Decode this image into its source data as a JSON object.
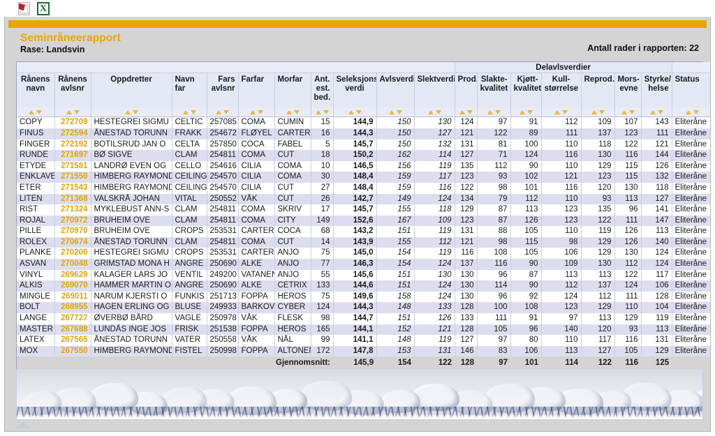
{
  "export_bar": {
    "pdf": {
      "icon": "pdf-export-icon",
      "title": "PDF"
    },
    "excel": {
      "icon": "excel-export-icon",
      "title": "Excel",
      "glyph": "X"
    }
  },
  "report": {
    "title": "Seminråneerapport",
    "title_text": "Seminråneerapport",
    "subtitle": "Rase: Landsvin",
    "row_count_label": "Antall rader i rapporten: 22",
    "accent_color": "#e8a607",
    "avlsnr_color": "#e0a30b"
  },
  "table": {
    "group_header": "Delavlsverdier",
    "columns": [
      "Rånens navn",
      "Rånens avlsnr",
      "Oppdretter",
      "Navn far",
      "Fars avlsnr",
      "Farfar",
      "Morfar",
      "Ant. est. bed.",
      "Seleksjons- verdi",
      "Avlsverdi",
      "Slektverdi",
      "Prod.",
      "Slakte- kvalitet",
      "Kjøtt- kvalitet",
      "Kull- størrelse",
      "Reprod.",
      "Mors- evne",
      "Styrke/ helse",
      "Status"
    ],
    "columns_split": [
      [
        "Rånens",
        "navn"
      ],
      [
        "Rånens",
        "avlsnr"
      ],
      [
        "Oppdretter",
        ""
      ],
      [
        "Navn far",
        ""
      ],
      [
        "Fars",
        "avlsnr"
      ],
      [
        "Farfar",
        ""
      ],
      [
        "Morfar",
        ""
      ],
      [
        "Ant.",
        "est.",
        "bed."
      ],
      [
        "Seleksjons-",
        "verdi"
      ],
      [
        "Avlsverdi",
        ""
      ],
      [
        "Slektverdi",
        ""
      ],
      [
        "Prod.",
        ""
      ],
      [
        "Slakte-",
        "kvalitet"
      ],
      [
        "Kjøtt-",
        "kvalitet"
      ],
      [
        "Kull-",
        "størrelse"
      ],
      [
        "Reprod.",
        ""
      ],
      [
        "Mors-",
        "evne"
      ],
      [
        "Styrke/",
        "helse"
      ],
      [
        "Status",
        ""
      ]
    ],
    "sort_icons": {
      "asc": "sort-ascending-icon",
      "desc": "sort-descending-icon"
    },
    "rows": [
      [
        "COPY",
        "272709",
        "HESTEGREI SIGMU",
        "CELTIC",
        "257085",
        "COMA",
        "CUMIN",
        "15",
        "144,9",
        "150",
        "130",
        "124",
        "97",
        "91",
        "112",
        "109",
        "107",
        "143",
        "Eliteråne"
      ],
      [
        "FINUS",
        "272594",
        "ÅNESTAD TORUNN",
        "FRAKK",
        "254672",
        "FLØYEL",
        "CARTER",
        "16",
        "144,3",
        "150",
        "127",
        "121",
        "122",
        "89",
        "111",
        "137",
        "123",
        "111",
        "Eliteråne"
      ],
      [
        "FINGER",
        "272192",
        "BOTILSRUD JAN O",
        "CELTA",
        "257850",
        "COCA",
        "FABEL",
        "5",
        "145,7",
        "150",
        "132",
        "131",
        "81",
        "100",
        "110",
        "118",
        "122",
        "121",
        "Eliteråne"
      ],
      [
        "RUNDE",
        "271697",
        "BØ SIGVE",
        "CLAM",
        "254811",
        "COMA",
        "CUT",
        "18",
        "150,2",
        "162",
        "114",
        "127",
        "71",
        "124",
        "116",
        "130",
        "116",
        "144",
        "Eliteråne"
      ],
      [
        "ETYDE",
        "271581",
        "LANDRØ EVEN OG",
        "CELLO",
        "254616",
        "CILIA",
        "COMA",
        "10",
        "146,5",
        "156",
        "119",
        "135",
        "112",
        "90",
        "110",
        "129",
        "115",
        "126",
        "Eliteråne"
      ],
      [
        "ENKLAVE",
        "271550",
        "HIMBERG RAYMOND",
        "CEILING",
        "254570",
        "CILIA",
        "COMA",
        "30",
        "148,4",
        "159",
        "117",
        "123",
        "93",
        "102",
        "121",
        "123",
        "115",
        "132",
        "Eliteråne"
      ],
      [
        "ETER",
        "271543",
        "HIMBERG RAYMOND",
        "CEILING",
        "254570",
        "CILIA",
        "CUT",
        "27",
        "148,4",
        "159",
        "116",
        "122",
        "98",
        "101",
        "116",
        "120",
        "130",
        "118",
        "Eliteråne"
      ],
      [
        "LITEN",
        "271368",
        "VALSKRÅ JOHAN",
        "VITAL",
        "250552",
        "VÅK",
        "CUT",
        "26",
        "142,7",
        "149",
        "124",
        "134",
        "79",
        "112",
        "110",
        "93",
        "113",
        "127",
        "Eliteråne"
      ],
      [
        "RIST",
        "271324",
        "MYKLEBUST ANN-S",
        "CLAM",
        "254811",
        "COMA",
        "SKRIV",
        "17",
        "145,7",
        "155",
        "118",
        "129",
        "87",
        "113",
        "123",
        "135",
        "96",
        "141",
        "Eliteråne"
      ],
      [
        "ROJAL",
        "270972",
        "BRUHEIM OVE",
        "CLAM",
        "254811",
        "COMA",
        "CITY",
        "149",
        "152,6",
        "167",
        "109",
        "123",
        "87",
        "126",
        "123",
        "122",
        "111",
        "147",
        "Eliteråne"
      ],
      [
        "PILLE",
        "270970",
        "BRUHEIM OVE",
        "CROPS",
        "253531",
        "CARTER",
        "COCA",
        "68",
        "143,2",
        "151",
        "119",
        "131",
        "88",
        "105",
        "110",
        "119",
        "126",
        "113",
        "Eliteråne"
      ],
      [
        "ROLEX",
        "270674",
        "ÅNESTAD TORUNN",
        "CLAM",
        "254811",
        "COMA",
        "CUT",
        "14",
        "143,9",
        "155",
        "112",
        "121",
        "98",
        "115",
        "98",
        "129",
        "126",
        "140",
        "Eliteråne"
      ],
      [
        "PLANKE",
        "270200",
        "HESTEGREI SIGMU",
        "CROPS",
        "253531",
        "CARTER",
        "ANJO",
        "75",
        "145,0",
        "154",
        "119",
        "116",
        "108",
        "105",
        "106",
        "129",
        "130",
        "124",
        "Eliteråne"
      ],
      [
        "ASVAN",
        "270048",
        "GRIMSTAD MONA H",
        "ANGRE",
        "250690",
        "ALKE",
        "ANJO",
        "77",
        "146,3",
        "154",
        "124",
        "137",
        "116",
        "90",
        "109",
        "130",
        "112",
        "124",
        "Eliteråne"
      ],
      [
        "VINYL",
        "269629",
        "KALAGER LARS JO",
        "VENTIL",
        "249200",
        "VATANEN",
        "ANJO",
        "55",
        "145,6",
        "151",
        "130",
        "130",
        "96",
        "87",
        "113",
        "113",
        "122",
        "117",
        "Eliteråne"
      ],
      [
        "ALKIS",
        "269070",
        "HAMMER MARTIN O",
        "ANGRE",
        "250690",
        "ALKE",
        "CETRIX",
        "133",
        "144,6",
        "151",
        "124",
        "130",
        "114",
        "90",
        "112",
        "137",
        "124",
        "106",
        "Eliteråne"
      ],
      [
        "MINGLE",
        "269011",
        "NARUM KJERSTI O",
        "FUNKIS",
        "251713",
        "FOPPA",
        "HEROS",
        "75",
        "149,6",
        "158",
        "124",
        "130",
        "96",
        "92",
        "124",
        "112",
        "111",
        "128",
        "Eliteråne"
      ],
      [
        "BOLT",
        "268955",
        "HAGEN ERLING OG",
        "BLUSE",
        "249933",
        "BARKOV",
        "CYBER",
        "124",
        "144,3",
        "148",
        "133",
        "128",
        "100",
        "108",
        "123",
        "129",
        "110",
        "104",
        "Eliteråne"
      ],
      [
        "LANGE",
        "267727",
        "ØVERBØ BÅRD",
        "VAGLE",
        "250978",
        "VÅK",
        "FLESK",
        "98",
        "144,7",
        "151",
        "126",
        "133",
        "111",
        "91",
        "97",
        "113",
        "129",
        "119",
        "Eliteråne"
      ],
      [
        "MASTER",
        "267688",
        "LUNDÅS INGE JOS",
        "FRISK",
        "251538",
        "FOPPA",
        "HEROS",
        "165",
        "144,1",
        "152",
        "121",
        "128",
        "105",
        "96",
        "140",
        "120",
        "93",
        "113",
        "Eliteråne"
      ],
      [
        "LATEX",
        "267565",
        "ÅNESTAD TORUNN",
        "VATER",
        "250558",
        "VÅK",
        "NÅL",
        "99",
        "141,1",
        "148",
        "119",
        "127",
        "97",
        "80",
        "110",
        "117",
        "116",
        "131",
        "Eliteråne"
      ],
      [
        "MOX",
        "267550",
        "HIMBERG RAYMOND",
        "FISTEL",
        "250998",
        "FOPPA",
        "ALTONEN",
        "172",
        "147,8",
        "153",
        "131",
        "146",
        "83",
        "106",
        "113",
        "127",
        "105",
        "129",
        "Eliteråne"
      ]
    ],
    "average_row": {
      "label": "Gjennomsnitt:",
      "values": [
        "145,9",
        "154",
        "122",
        "128",
        "97",
        "101",
        "114",
        "122",
        "116",
        "125",
        ""
      ]
    }
  },
  "footer": {
    "banner_alt": "decorative-piglets-image",
    "scroll_arrow": "scroll-up-arrow-icon"
  }
}
